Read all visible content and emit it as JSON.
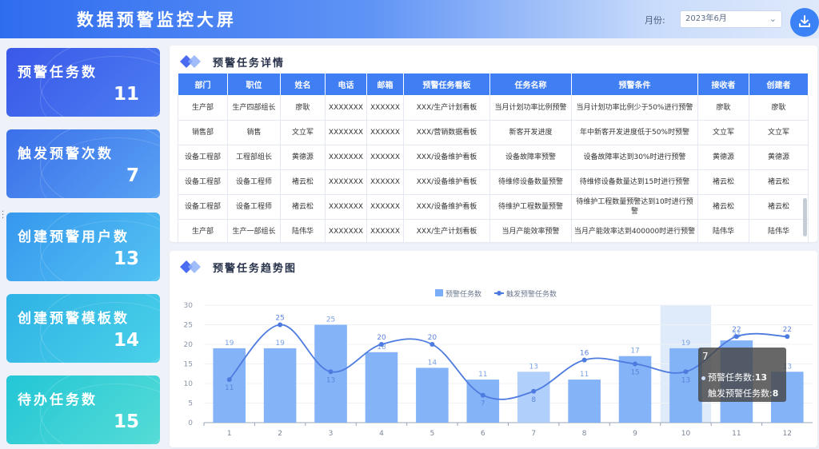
{
  "header": {
    "title": "数据预警监控大屏",
    "month_label": "月份:",
    "month_value": "2023年6月",
    "download_icon": "download-icon"
  },
  "stats": [
    {
      "label": "预警任务数",
      "value": "11"
    },
    {
      "label": "触发预警次数",
      "value": "7"
    },
    {
      "label": "创建预警用户数",
      "value": "13"
    },
    {
      "label": "创建预警模板数",
      "value": "14"
    },
    {
      "label": "待办任务数",
      "value": "15"
    }
  ],
  "task_panel": {
    "title": "预警任务详情",
    "columns": [
      "部门",
      "职位",
      "姓名",
      "电话",
      "邮箱",
      "预警任务看板",
      "任务名称",
      "预警条件",
      "接收者",
      "创建者"
    ],
    "rows": [
      [
        "生产部",
        "生产四部组长",
        "廖耿",
        "XXXXXXX",
        "XXXXXX",
        "XXX/生产计划看板",
        "当月计划功率比例预警",
        "当月计划功率比例少于50%进行预警",
        "廖耿",
        "廖耿"
      ],
      [
        "销售部",
        "销售",
        "文立军",
        "XXXXXXX",
        "XXXXXX",
        "XXX/营销数据看板",
        "新客开发进度",
        "年中新客开发进度低于50%时预警",
        "文立军",
        "文立军"
      ],
      [
        "设备工程部",
        "工程部组长",
        "黄德源",
        "XXXXXXX",
        "XXXXXX",
        "XXX/设备维护看板",
        "设备故障率预警",
        "设备故障率达到30%时进行预警",
        "黄德源",
        "黄德源"
      ],
      [
        "设备工程部",
        "设备工程师",
        "褚云松",
        "XXXXXXX",
        "XXXXXX",
        "XXX/设备维护看板",
        "待维修设备数量预警",
        "待维修设备数量达到15时进行预警",
        "褚云松",
        "褚云松"
      ],
      [
        "设备工程部",
        "设备工程师",
        "褚云松",
        "XXXXXXX",
        "XXXXXX",
        "XXX/设备维护看板",
        "待维护工程数量预警",
        "待维护工程数量预警达到10时进行预警",
        "褚云松",
        "褚云松"
      ],
      [
        "生产部",
        "生产一部组长",
        "陆伟华",
        "XXXXXXX",
        "XXXXXX",
        "XXX/生产计划看板",
        "当月产能效率预警",
        "当月产能效率达到400000时进行预警",
        "陆伟华",
        "陆伟华"
      ]
    ]
  },
  "trend_panel": {
    "title": "预警任务趋势图",
    "tooltip": {
      "category": "7",
      "row1_label": "预警任务数:",
      "row1_value": "13",
      "row2_label": "触发预警任务数:",
      "row2_value": "8"
    }
  },
  "chart_data": {
    "type": "bar",
    "categories": [
      "1",
      "2",
      "3",
      "4",
      "5",
      "6",
      "7",
      "8",
      "9",
      "10",
      "11",
      "12"
    ],
    "series": [
      {
        "name": "预警任务数",
        "type": "bar",
        "values": [
          19,
          19,
          25,
          18,
          14,
          11,
          13,
          11,
          17,
          19,
          21,
          13
        ]
      },
      {
        "name": "触发预警任务数",
        "type": "line",
        "values": [
          11,
          25,
          13,
          20,
          20,
          7,
          8,
          16,
          15,
          13,
          22,
          22
        ]
      }
    ],
    "ylim": [
      0,
      30
    ],
    "yticks": [
      0,
      5,
      10,
      15,
      20,
      25,
      30
    ],
    "legend": "top-center",
    "colors": {
      "bar": "#7aaef6",
      "bar_highlight": "#a9cbfb",
      "line": "#4e7be0",
      "hover_band": "#dfeafb"
    },
    "hover_category": "10"
  }
}
